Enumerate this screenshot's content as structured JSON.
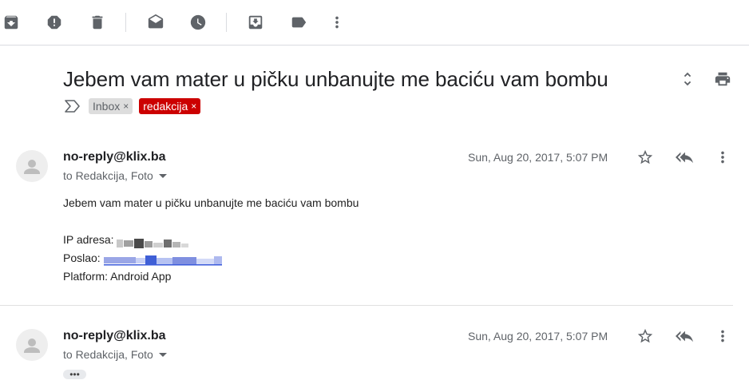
{
  "toolbar": {
    "icons": [
      "archive-icon",
      "report-spam-icon",
      "delete-icon",
      "mark-unread-icon",
      "snooze-icon",
      "move-to-icon",
      "label-icon",
      "more-vert-icon"
    ]
  },
  "thread": {
    "subject": "Jebem vam mater u pičku unbanujte me baciću vam bombu",
    "labels": [
      {
        "name": "Inbox",
        "remove": "×",
        "color": "#dddddd"
      },
      {
        "name": "redakcija",
        "remove": "×",
        "color": "#cc0000"
      }
    ]
  },
  "messages": [
    {
      "sender": "no-reply@klix.ba",
      "to": "to Redakcija, Foto",
      "date": "Sun, Aug 20, 2017, 5:07 PM",
      "body": {
        "line1": "Jebem vam mater u pičku unbanujte me baciću vam bombu",
        "ip_label": "IP adresa:",
        "poslao_label": "Poslao:",
        "platform": "Platform: Android App"
      }
    },
    {
      "sender": "no-reply@klix.ba",
      "to": "to Redakcija, Foto",
      "date": "Sun, Aug 20, 2017, 5:07 PM",
      "trimmed": "•••"
    }
  ],
  "colors": {
    "icon_gray": "#5f6368",
    "label_red": "#cc0000",
    "link_blue": "#1a0dab"
  }
}
